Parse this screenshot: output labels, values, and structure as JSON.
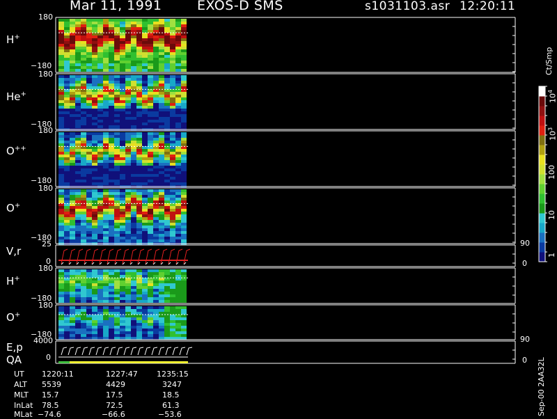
{
  "header": {
    "date": "Mar 11, 1991",
    "instrument": "EXOS-D SMS",
    "file": "s1031103.asr",
    "time": "12:20:11"
  },
  "panels": [
    {
      "label": "H",
      "sup": "+",
      "ymax": "180",
      "ymin": "−180"
    },
    {
      "label": "He",
      "sup": "+",
      "ymax": "180",
      "ymin": "−180"
    },
    {
      "label": "O",
      "sup": "++",
      "ymax": "180",
      "ymin": "−180"
    },
    {
      "label": "O",
      "sup": "+",
      "ymax": "180",
      "ymin": "−180"
    },
    {
      "label": "V,r",
      "sup": "",
      "ymax": "25",
      "ymin": "0",
      "right_top": "90",
      "right_bottom": "0"
    },
    {
      "label": "H",
      "sup": "+",
      "ymax": "180",
      "ymin": "−180"
    },
    {
      "label": "O",
      "sup": "+",
      "ymax": "180",
      "ymin": "−180"
    },
    {
      "label": "E,p",
      "sup": "",
      "label2": "QA",
      "ymax": "4000",
      "ymin": "0",
      "right_top": "90",
      "right_bottom": "0"
    }
  ],
  "colorbar": {
    "unit": "Ct/Smp",
    "ticks": [
      "1",
      "10",
      "100",
      "10",
      "10"
    ],
    "tick_sups": [
      "",
      "",
      "",
      "3",
      "4"
    ],
    "colors": [
      "#10107a",
      "#0a3aa0",
      "#1a70c0",
      "#18a8c8",
      "#30c8d0",
      "#1a9a1a",
      "#30c030",
      "#60d030",
      "#a0e040",
      "#d0e030",
      "#e8e020",
      "#b0a010",
      "#807010",
      "#e02010",
      "#c01010",
      "#901010",
      "#6a0a0a",
      "#ffffff"
    ]
  },
  "footer": {
    "rows": [
      {
        "name": "UT",
        "values": [
          "1220:11",
          "1227:47",
          "1235:15"
        ]
      },
      {
        "name": "ALT",
        "values": [
          "5539",
          "4429",
          "3247"
        ]
      },
      {
        "name": "MLT",
        "values": [
          "15.7",
          "17.5",
          "18.5"
        ]
      },
      {
        "name": "InLat",
        "values": [
          "78.5",
          "72.5",
          "61.3"
        ]
      },
      {
        "name": "MLat",
        "values": [
          "−74.6",
          "−66.6",
          "−53.6"
        ]
      }
    ],
    "version": "Sep-00 2AA32L"
  },
  "chart_data": {
    "type": "heatmap",
    "title": "Mar 11, 1991   EXOS-D SMS",
    "x": [
      "1220:11",
      "1227:47",
      "1235:15"
    ],
    "series": [
      {
        "name": "H+",
        "ylim": [
          -180,
          180
        ]
      },
      {
        "name": "He+",
        "ylim": [
          -180,
          180
        ]
      },
      {
        "name": "O++",
        "ylim": [
          -180,
          180
        ]
      },
      {
        "name": "O+",
        "ylim": [
          -180,
          180
        ]
      },
      {
        "name": "V,r",
        "ylim": [
          0,
          25
        ],
        "ylim_right": [
          0,
          90
        ]
      },
      {
        "name": "H+",
        "ylim": [
          -180,
          180
        ]
      },
      {
        "name": "O+",
        "ylim": [
          -180,
          180
        ]
      },
      {
        "name": "E,p",
        "ylim": [
          0,
          4000
        ],
        "ylim_right": [
          0,
          90
        ]
      }
    ],
    "color_scale": {
      "unit": "Ct/Smp",
      "range": [
        1,
        10000
      ],
      "log": true
    }
  }
}
